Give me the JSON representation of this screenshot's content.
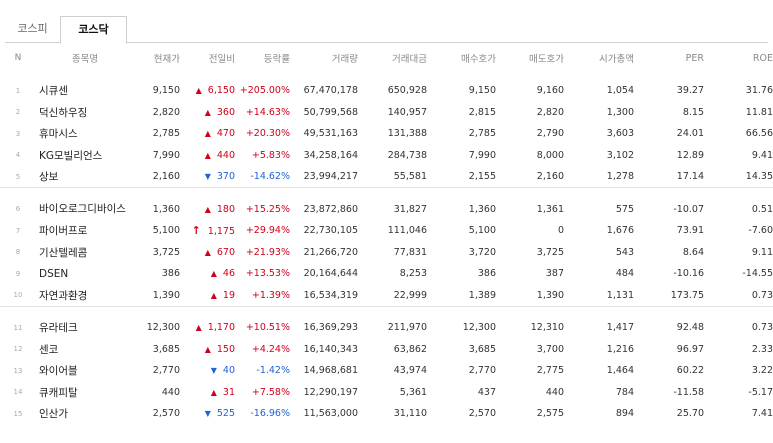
{
  "tabs": [
    {
      "label": "코스피",
      "active": false
    },
    {
      "label": "코스닥",
      "active": true
    }
  ],
  "columns": [
    "N",
    "종목명",
    "현재가",
    "전일비",
    "등락률",
    "거래량",
    "거래대금",
    "매수호가",
    "매도호가",
    "시가총액",
    "PER",
    "ROE"
  ],
  "rows": [
    {
      "n": "1",
      "name": "시큐센",
      "price": "9,150",
      "dir": "up",
      "change": "6,150",
      "rate": "+205.00%",
      "volume": "67,470,178",
      "amount": "650,928",
      "bid": "9,150",
      "ask": "9,160",
      "cap": "1,054",
      "per": "39.27",
      "roe": "31.76"
    },
    {
      "n": "2",
      "name": "덕신하우징",
      "price": "2,820",
      "dir": "up",
      "change": "360",
      "rate": "+14.63%",
      "volume": "50,799,568",
      "amount": "140,957",
      "bid": "2,815",
      "ask": "2,820",
      "cap": "1,300",
      "per": "8.15",
      "roe": "11.81"
    },
    {
      "n": "3",
      "name": "휴마시스",
      "price": "2,785",
      "dir": "up",
      "change": "470",
      "rate": "+20.30%",
      "volume": "49,531,163",
      "amount": "131,388",
      "bid": "2,785",
      "ask": "2,790",
      "cap": "3,603",
      "per": "24.01",
      "roe": "66.56"
    },
    {
      "n": "4",
      "name": "KG모빌리언스",
      "price": "7,990",
      "dir": "up",
      "change": "440",
      "rate": "+5.83%",
      "volume": "34,258,164",
      "amount": "284,738",
      "bid": "7,990",
      "ask": "8,000",
      "cap": "3,102",
      "per": "12.89",
      "roe": "9.41"
    },
    {
      "n": "5",
      "name": "상보",
      "price": "2,160",
      "dir": "down",
      "change": "370",
      "rate": "-14.62%",
      "volume": "23,994,217",
      "amount": "55,581",
      "bid": "2,155",
      "ask": "2,160",
      "cap": "1,278",
      "per": "17.14",
      "roe": "14.35"
    },
    {
      "n": "6",
      "name": "바이오로그디바이스",
      "price": "1,360",
      "dir": "up",
      "change": "180",
      "rate": "+15.25%",
      "volume": "23,872,860",
      "amount": "31,827",
      "bid": "1,360",
      "ask": "1,361",
      "cap": "575",
      "per": "-10.07",
      "roe": "0.51"
    },
    {
      "n": "7",
      "name": "파이버프로",
      "price": "5,100",
      "dir": "upper",
      "change": "1,175",
      "rate": "+29.94%",
      "volume": "22,730,105",
      "amount": "111,046",
      "bid": "5,100",
      "ask": "0",
      "cap": "1,676",
      "per": "73.91",
      "roe": "-7.60"
    },
    {
      "n": "8",
      "name": "기산텔레콤",
      "price": "3,725",
      "dir": "up",
      "change": "670",
      "rate": "+21.93%",
      "volume": "21,266,720",
      "amount": "77,831",
      "bid": "3,720",
      "ask": "3,725",
      "cap": "543",
      "per": "8.64",
      "roe": "9.11"
    },
    {
      "n": "9",
      "name": "DSEN",
      "price": "386",
      "dir": "up",
      "change": "46",
      "rate": "+13.53%",
      "volume": "20,164,644",
      "amount": "8,253",
      "bid": "386",
      "ask": "387",
      "cap": "484",
      "per": "-10.16",
      "roe": "-14.55"
    },
    {
      "n": "10",
      "name": "자연과환경",
      "price": "1,390",
      "dir": "up",
      "change": "19",
      "rate": "+1.39%",
      "volume": "16,534,319",
      "amount": "22,999",
      "bid": "1,389",
      "ask": "1,390",
      "cap": "1,131",
      "per": "173.75",
      "roe": "0.73"
    },
    {
      "n": "11",
      "name": "유라테크",
      "price": "12,300",
      "dir": "up",
      "change": "1,170",
      "rate": "+10.51%",
      "volume": "16,369,293",
      "amount": "211,970",
      "bid": "12,300",
      "ask": "12,310",
      "cap": "1,417",
      "per": "92.48",
      "roe": "0.73"
    },
    {
      "n": "12",
      "name": "센코",
      "price": "3,685",
      "dir": "up",
      "change": "150",
      "rate": "+4.24%",
      "volume": "16,140,343",
      "amount": "63,862",
      "bid": "3,685",
      "ask": "3,700",
      "cap": "1,216",
      "per": "96.97",
      "roe": "2.33"
    },
    {
      "n": "13",
      "name": "와이어블",
      "price": "2,770",
      "dir": "down",
      "change": "40",
      "rate": "-1.42%",
      "volume": "14,968,681",
      "amount": "43,974",
      "bid": "2,770",
      "ask": "2,775",
      "cap": "1,464",
      "per": "60.22",
      "roe": "3.22"
    },
    {
      "n": "14",
      "name": "큐캐피탈",
      "price": "440",
      "dir": "up",
      "change": "31",
      "rate": "+7.58%",
      "volume": "12,290,197",
      "amount": "5,361",
      "bid": "437",
      "ask": "440",
      "cap": "784",
      "per": "-11.58",
      "roe": "-5.17"
    },
    {
      "n": "15",
      "name": "인산가",
      "price": "2,570",
      "dir": "down",
      "change": "525",
      "rate": "-16.96%",
      "volume": "11,563,000",
      "amount": "31,110",
      "bid": "2,570",
      "ask": "2,575",
      "cap": "894",
      "per": "25.70",
      "roe": "7.41"
    }
  ],
  "icons": {
    "up": "triangle-up-icon",
    "down": "triangle-down-icon",
    "upper": "upper-limit-arrow-icon"
  },
  "colors": {
    "up": "#d0021b",
    "down": "#1f63d6"
  }
}
